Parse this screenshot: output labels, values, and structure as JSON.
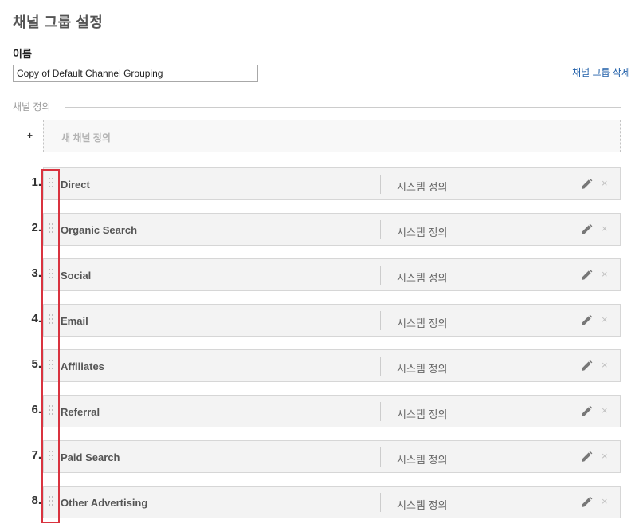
{
  "header": {
    "title": "채널 그룹 설정"
  },
  "name_field": {
    "label": "이름",
    "value": "Copy of Default Channel Grouping"
  },
  "delete_link": "채널 그룹 삭제",
  "section": {
    "title": "채널 정의"
  },
  "new_channel": {
    "plus": "+",
    "label": "새 채널 정의"
  },
  "channels": [
    {
      "num": "1.",
      "name": "Direct",
      "type": "시스템 정의"
    },
    {
      "num": "2.",
      "name": "Organic Search",
      "type": "시스템 정의"
    },
    {
      "num": "3.",
      "name": "Social",
      "type": "시스템 정의"
    },
    {
      "num": "4.",
      "name": "Email",
      "type": "시스템 정의"
    },
    {
      "num": "5.",
      "name": "Affiliates",
      "type": "시스템 정의"
    },
    {
      "num": "6.",
      "name": "Referral",
      "type": "시스템 정의"
    },
    {
      "num": "7.",
      "name": "Paid Search",
      "type": "시스템 정의"
    },
    {
      "num": "8.",
      "name": "Other Advertising",
      "type": "시스템 정의"
    }
  ],
  "icons": {
    "drag": "drag-handle-icon",
    "edit": "pencil-icon",
    "delete": "close-icon"
  },
  "colors": {
    "link": "#1f5ea8",
    "highlight": "#d9333f",
    "row_bg": "#f3f3f3"
  }
}
